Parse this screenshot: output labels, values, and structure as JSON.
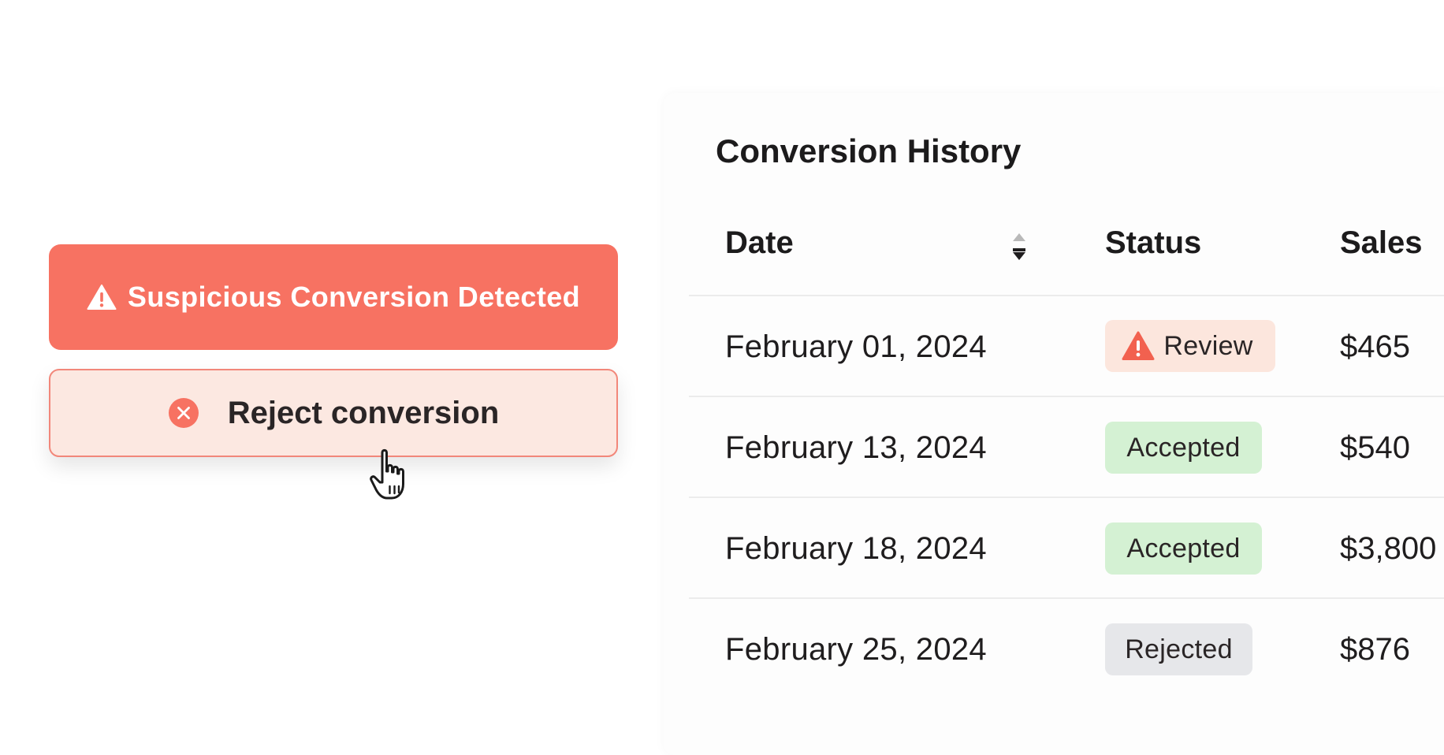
{
  "alert": {
    "icon": "warning-triangle-icon",
    "text": "Suspicious Conversion Detected",
    "color": "#f77262"
  },
  "reject_button": {
    "icon": "close-circle-icon",
    "label": "Reject conversion",
    "background": "#fce8e1",
    "border_color": "#f2877a"
  },
  "cursor": {
    "icon": "hand-pointer-icon"
  },
  "table": {
    "title": "Conversion History",
    "columns": {
      "date": "Date",
      "status": "Status",
      "sales": "Sales"
    },
    "sort_icon": "sort-toggle-icon",
    "rows": [
      {
        "date": "February 01, 2024",
        "status": "Review",
        "status_kind": "review",
        "sales": "$465"
      },
      {
        "date": "February 13, 2024",
        "status": "Accepted",
        "status_kind": "accepted",
        "sales": "$540"
      },
      {
        "date": "February 18, 2024",
        "status": "Accepted",
        "status_kind": "accepted",
        "sales": "$3,800"
      },
      {
        "date": "February 25, 2024",
        "status": "Rejected",
        "status_kind": "rejected",
        "sales": "$876"
      }
    ],
    "status_colors": {
      "review": "#fce6dd",
      "accepted": "#d4f1d3",
      "rejected": "#e6e7ea"
    }
  }
}
